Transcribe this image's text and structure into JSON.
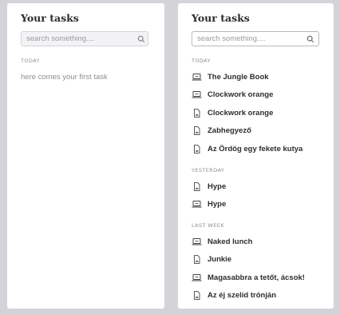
{
  "left_panel": {
    "title": "Your tasks",
    "search_placeholder": "search something....",
    "sections": [
      {
        "label": "TODAY",
        "empty_text": "here comes your first task"
      }
    ]
  },
  "right_panel": {
    "title": "Your tasks",
    "search_placeholder": "search something....",
    "sections": [
      {
        "label": "TODAY",
        "items": [
          {
            "label": "The Jungle Book",
            "icon": "laptop-icon"
          },
          {
            "label": "Clockwork orange",
            "icon": "laptop-icon"
          },
          {
            "label": "Clockwork orange",
            "icon": "document-icon"
          },
          {
            "label": "Zabhegyező",
            "icon": "document-icon"
          },
          {
            "label": "Az Ördög egy fekete kutya",
            "icon": "document-icon"
          }
        ]
      },
      {
        "label": "YESTERDAY",
        "items": [
          {
            "label": "Hype",
            "icon": "document-icon"
          },
          {
            "label": "Hype",
            "icon": "laptop-icon"
          }
        ]
      },
      {
        "label": "LAST WEEK",
        "items": [
          {
            "label": "Naked lunch",
            "icon": "laptop-icon"
          },
          {
            "label": "Junkie",
            "icon": "document-icon"
          },
          {
            "label": "Magasabbra a tetőt, ácsok!",
            "icon": "laptop-icon"
          },
          {
            "label": "Az éj szelíd trónján",
            "icon": "document-icon"
          }
        ]
      }
    ]
  },
  "colors": {
    "background": "#d4d3d8",
    "panel": "#ffffff",
    "text_primary": "#2d2d2d",
    "text_muted": "#8f8f96"
  }
}
